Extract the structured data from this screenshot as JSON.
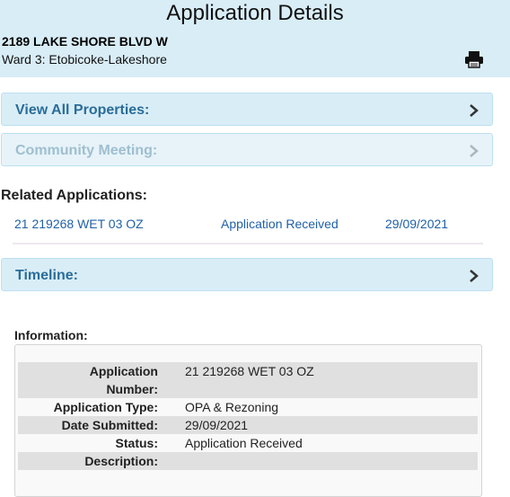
{
  "header": {
    "title": "Application Details",
    "address": "2189 LAKE SHORE BLVD W",
    "ward": "Ward 3: Etobicoke-Lakeshore",
    "print_icon": "printer-icon"
  },
  "panels": [
    {
      "label": "View All Properties:",
      "enabled": true
    },
    {
      "label": "Community Meeting:",
      "enabled": false
    },
    {
      "label": "Timeline:",
      "enabled": true
    }
  ],
  "related": {
    "title": "Related Applications:",
    "rows": [
      {
        "number": "21 219268 WET 03 OZ",
        "status": "Application Received",
        "date": "29/09/2021"
      }
    ]
  },
  "information": {
    "title": "Information:",
    "fields": [
      {
        "label_line1": "Application",
        "label_line2": "Number:",
        "value": "21 219268 WET 03 OZ"
      },
      {
        "label": "Application Type:",
        "value": "OPA & Rezoning"
      },
      {
        "label": "Date Submitted:",
        "value": "29/09/2021"
      },
      {
        "label": "Status:",
        "value": "Application Received"
      },
      {
        "label": "Description:",
        "value": ""
      }
    ]
  },
  "colors": {
    "header_bg": "#d9edf7",
    "panel_text": "#2a6d99",
    "link": "#2061a8"
  }
}
